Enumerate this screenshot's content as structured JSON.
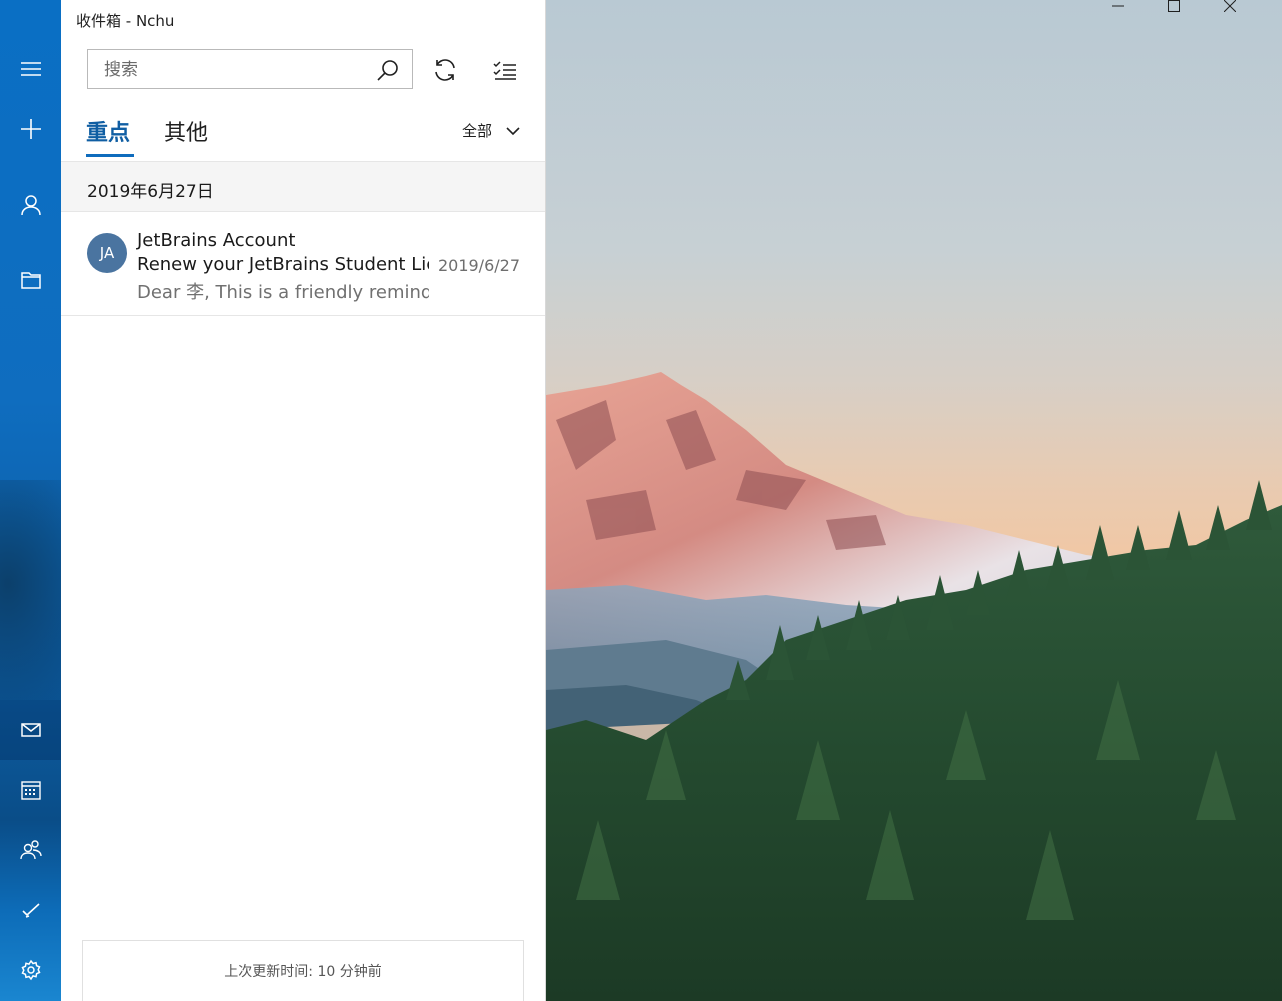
{
  "window": {
    "title": "收件箱 - Nchu"
  },
  "search": {
    "placeholder": "搜索"
  },
  "tabs": [
    {
      "label": "重点",
      "active": true
    },
    {
      "label": "其他",
      "active": false
    }
  ],
  "filter": {
    "label": "全部"
  },
  "date_group": "2019年6月27日",
  "messages": [
    {
      "avatar": "JA",
      "sender": "JetBrains Account",
      "subject": "Renew your JetBrains Student License",
      "date": "2019/6/27",
      "preview": "Dear 李, This is a friendly reminder"
    }
  ],
  "status": "上次更新时间: 10 分钟前",
  "nav": {
    "top": [
      "menu-icon",
      "new-mail-icon",
      "account-icon",
      "folder-icon"
    ],
    "bottom": [
      "mail-icon",
      "calendar-icon",
      "people-icon",
      "todo-icon",
      "settings-icon"
    ]
  },
  "colors": {
    "accent": "#0f6cbd",
    "rail": "#0a6fc4",
    "avatar": "#4a74a0"
  }
}
